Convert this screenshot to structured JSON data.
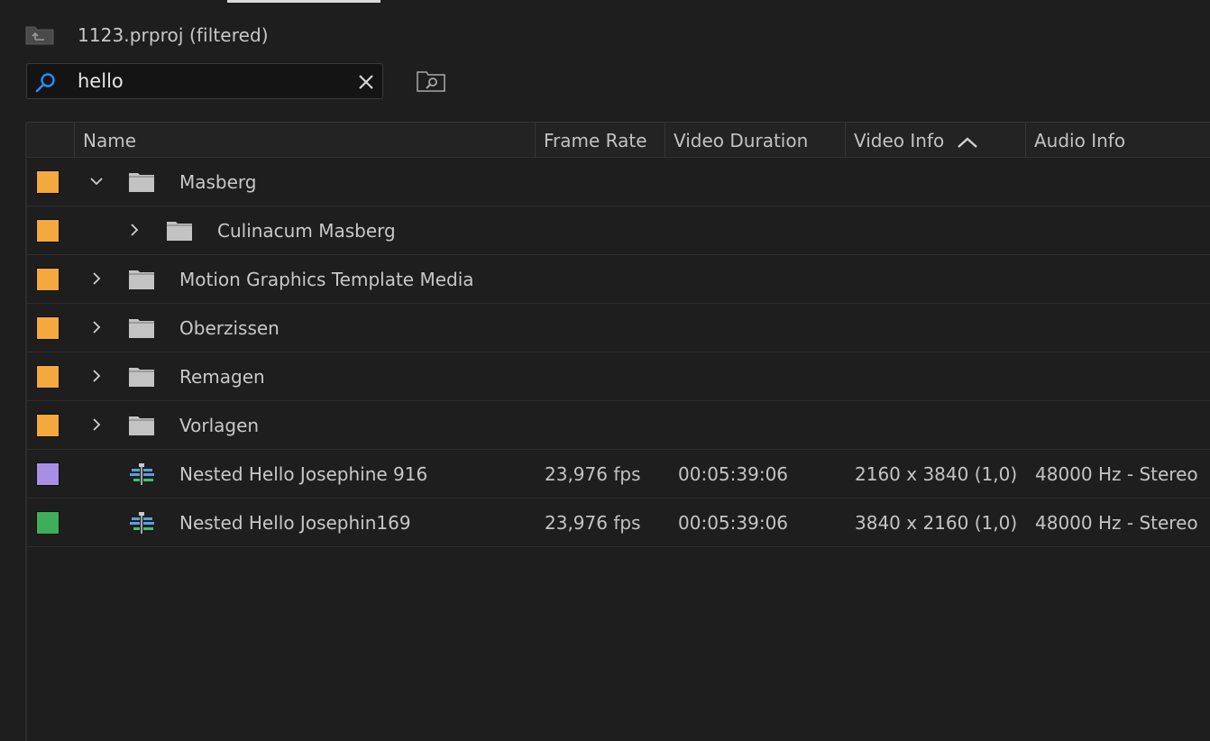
{
  "project": {
    "title": "1123.prproj (filtered)",
    "icon": "project-up-folder-icon"
  },
  "search": {
    "value": "hello",
    "placeholder": ""
  },
  "columns": [
    "Name",
    "Frame Rate",
    "Video Duration",
    "Video Info",
    "Audio Info"
  ],
  "sort_column": "Video Info",
  "rows": [
    {
      "label_color": "#f4a93e",
      "expanded": true,
      "type": "bin",
      "name": "Masberg",
      "frame_rate": "",
      "duration": "",
      "video_info": "",
      "audio_info": ""
    },
    {
      "label_color": "#f4a93e",
      "expanded": false,
      "type": "bin",
      "name": "Culinacum Masberg",
      "frame_rate": "",
      "duration": "",
      "video_info": "",
      "audio_info": ""
    },
    {
      "label_color": "#f4a93e",
      "expanded": false,
      "type": "bin",
      "name": "Motion Graphics Template Media",
      "frame_rate": "",
      "duration": "",
      "video_info": "",
      "audio_info": ""
    },
    {
      "label_color": "#f4a93e",
      "expanded": false,
      "type": "bin",
      "name": "Oberzissen",
      "frame_rate": "",
      "duration": "",
      "video_info": "",
      "audio_info": ""
    },
    {
      "label_color": "#f4a93e",
      "expanded": false,
      "type": "bin",
      "name": "Remagen",
      "frame_rate": "",
      "duration": "",
      "video_info": "",
      "audio_info": ""
    },
    {
      "label_color": "#f4a93e",
      "expanded": false,
      "type": "bin",
      "name": "Vorlagen",
      "frame_rate": "",
      "duration": "",
      "video_info": "",
      "audio_info": ""
    },
    {
      "label_color": "#a88fe6",
      "type": "sequence",
      "name": "Nested Hello Josephine 916",
      "frame_rate": "23,976 fps",
      "duration": "00:05:39:06",
      "video_info": "2160 x 3840 (1,0)",
      "audio_info": "48000 Hz - Stereo"
    },
    {
      "label_color": "#3dae5a",
      "type": "sequence",
      "name": "Nested Hello Josephin169",
      "frame_rate": "23,976 fps",
      "duration": "00:05:39:06",
      "video_info": "3840 x 2160 (1,0)",
      "audio_info": "48000 Hz - Stereo"
    }
  ]
}
